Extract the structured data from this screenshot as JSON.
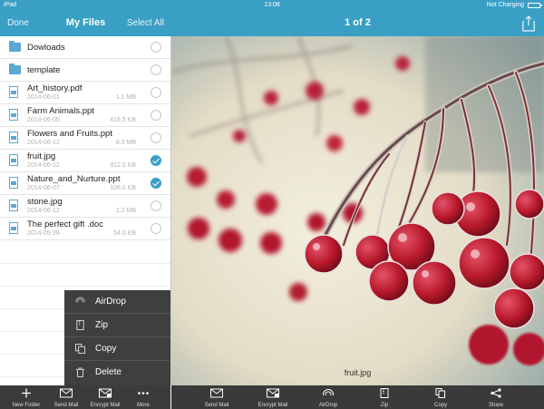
{
  "status_bar": {
    "carrier": "iPad",
    "time": "13:08",
    "battery": "Not Charging"
  },
  "left_nav": {
    "done": "Done",
    "title": "My Files",
    "select_all": "Select All"
  },
  "right_nav": {
    "page_count": "1 of 2"
  },
  "files": [
    {
      "type": "folder",
      "name": "Dowloads",
      "date": "",
      "size": "",
      "checked": false
    },
    {
      "type": "folder",
      "name": "template",
      "date": "",
      "size": "",
      "checked": false
    },
    {
      "type": "file",
      "name": "Art_history.pdf",
      "date": "2014-06-01",
      "size": "1.1 MB",
      "checked": false
    },
    {
      "type": "file",
      "name": "Farm Animals.ppt",
      "date": "2014-06-05",
      "size": "416.5 KB",
      "checked": false
    },
    {
      "type": "file",
      "name": "Flowers and Fruits.ppt",
      "date": "2014-06-12",
      "size": "6.0 MB",
      "checked": false
    },
    {
      "type": "file",
      "name": "fruit.jpg",
      "date": "2014-06-12",
      "size": "912.0 KB",
      "checked": true
    },
    {
      "type": "file",
      "name": "Nature_and_Nurture.ppt",
      "date": "2014-06-07",
      "size": "106.0 KB",
      "checked": true
    },
    {
      "type": "file",
      "name": "stone.jpg",
      "date": "2014-06-12",
      "size": "1.2 MB",
      "checked": false
    },
    {
      "type": "file",
      "name": "The perfect gift .doc",
      "date": "2014-05-28",
      "size": "54.0 KB",
      "checked": false
    }
  ],
  "action_menu": {
    "airdrop": "AirDrop",
    "zip": "Zip",
    "copy": "Copy",
    "delete": "Delete"
  },
  "preview": {
    "caption": "fruit.jpg"
  },
  "left_toolbar": {
    "new_folder": "New Folder",
    "send_mail": "Send Mail",
    "encrypt_mail": "Encrypt Mail",
    "more": "More"
  },
  "right_toolbar": {
    "send_mail": "Send Mail",
    "encrypt_mail": "Encrypt Mail",
    "airdrop": "AirDrop",
    "zip": "Zip",
    "copy": "Copy",
    "share": "Share"
  },
  "colors": {
    "accent": "#3a9fc4",
    "toolbar": "#3b3b3b",
    "popup": "#3f3f3f",
    "berry": "#b8192b"
  }
}
